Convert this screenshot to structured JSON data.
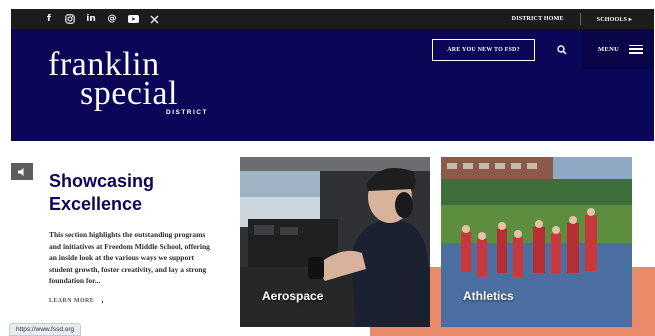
{
  "topbar": {
    "social": [
      {
        "icon": "facebook-icon",
        "glyph": "f"
      },
      {
        "icon": "instagram-icon",
        "glyph": ""
      },
      {
        "icon": "linkedin-icon",
        "glyph": "in"
      },
      {
        "icon": "threads-icon",
        "glyph": "@"
      },
      {
        "icon": "youtube-icon",
        "glyph": ""
      },
      {
        "icon": "x-icon",
        "glyph": "𝕏"
      }
    ],
    "links": [
      "DISTRICT HOME",
      "SCHOOLS ▸"
    ]
  },
  "header": {
    "logo": {
      "line1": "franklin",
      "line2": "special",
      "line3": "DISTRICT"
    },
    "new_button": "ARE YOU NEW TO FSD?",
    "menu_label": "MENU"
  },
  "feature": {
    "heading_line1": "Showcasing",
    "heading_line2": "Excellence",
    "description": "This section highlights the outstanding programs and initiatives at Freedom Middle School, offering an inside look at the various ways we support student growth, foster creativity, and lay a strong foundation for...",
    "learn_more": "LEARN MORE"
  },
  "cards": [
    {
      "label": "Aerospace"
    },
    {
      "label": "Athletics"
    }
  ],
  "status_url": "https://www.fssd.org",
  "colors": {
    "brand_navy": "#0b0658",
    "accent_coral": "#e98a68",
    "topbar": "#1c1c1c"
  }
}
